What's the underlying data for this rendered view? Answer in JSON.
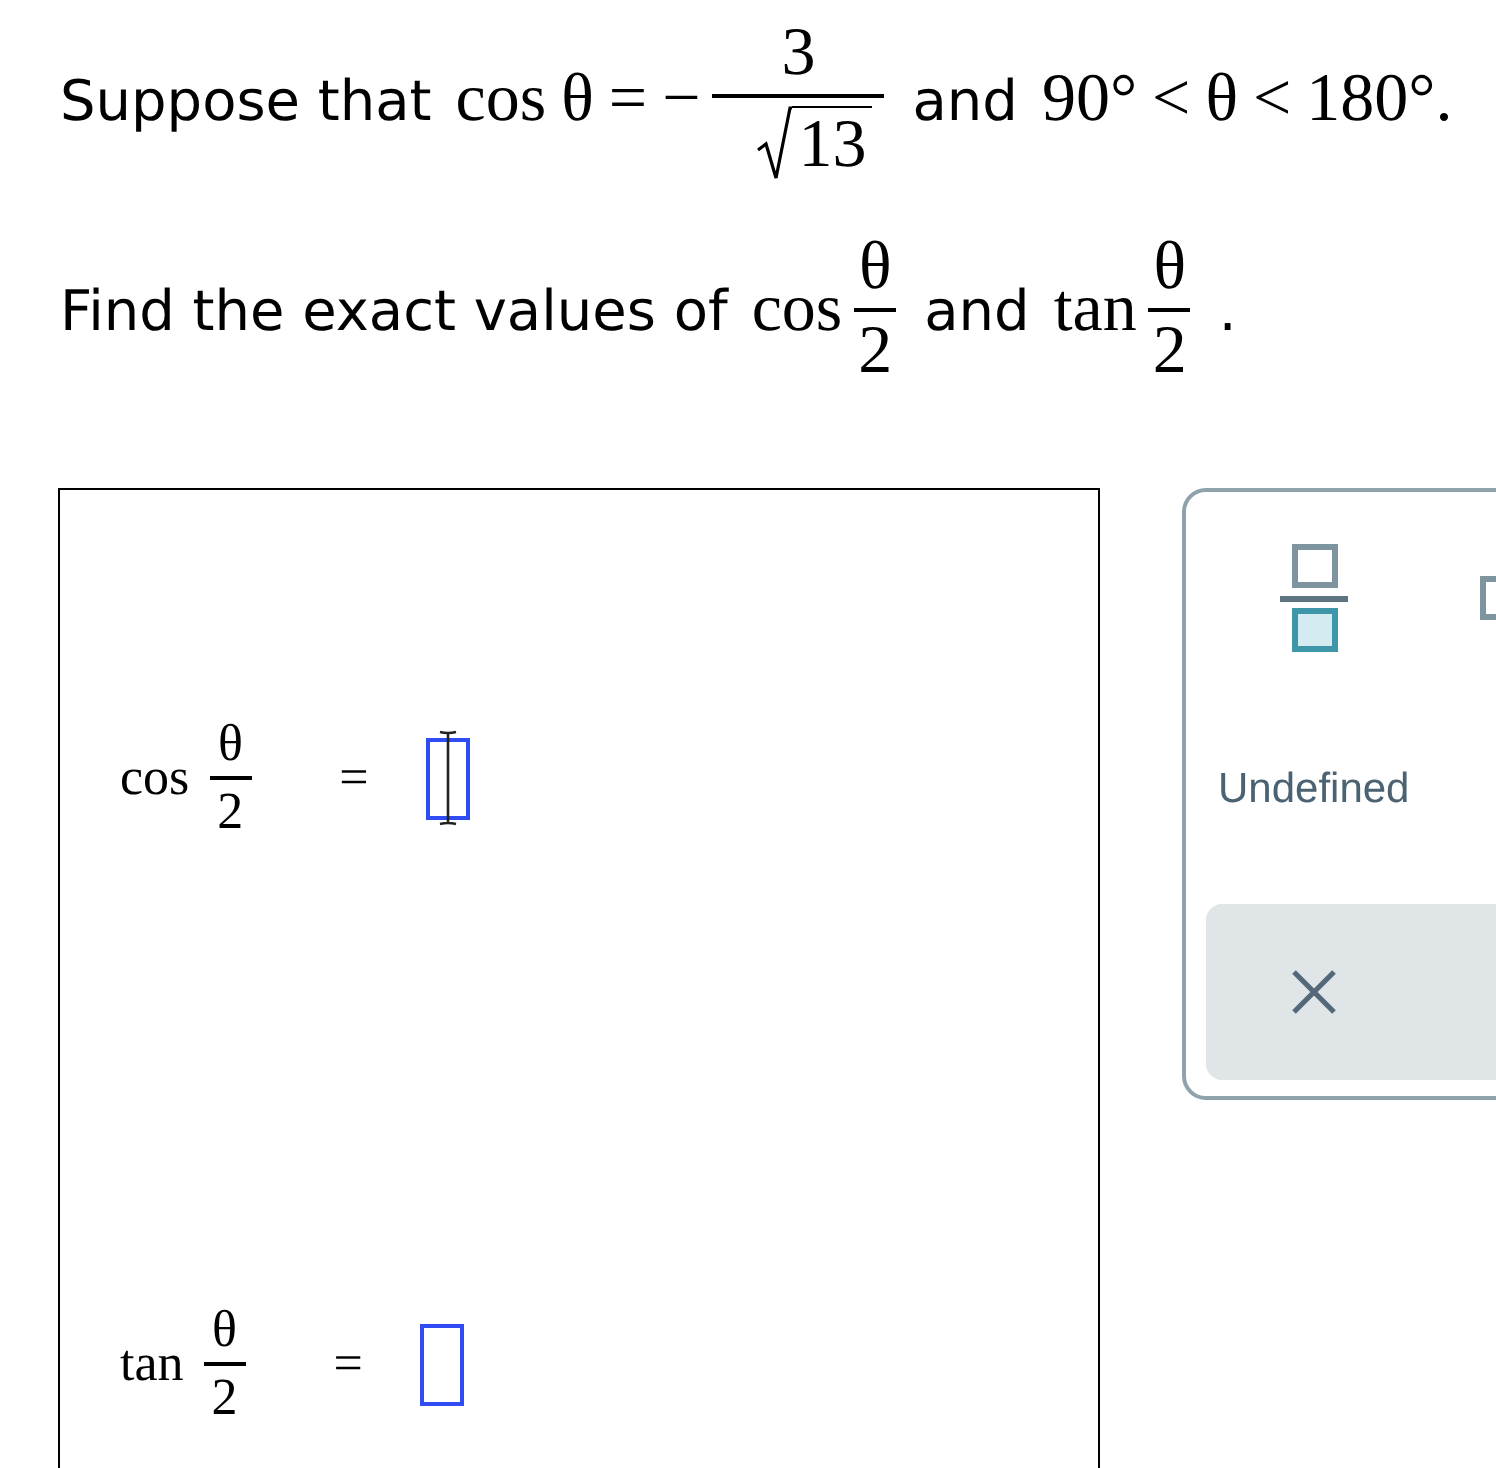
{
  "question": [
    [
      {
        "kind": "text",
        "text": "Suppose that"
      },
      {
        "kind": "math",
        "text": "cos θ = −"
      },
      {
        "kind": "fraction",
        "numerator": "3",
        "denominator": "13",
        "root": true
      },
      {
        "kind": "text",
        "text": "and"
      },
      {
        "kind": "math",
        "text": "90° < θ < 180°."
      }
    ],
    [
      {
        "kind": "text",
        "text": "Find the exact values of"
      },
      {
        "kind": "math",
        "text": "cos"
      },
      {
        "kind": "fraction",
        "numerator": "θ",
        "denominator": "2",
        "root": false
      },
      {
        "kind": "text",
        "text": "and"
      },
      {
        "kind": "math",
        "text": "tan"
      },
      {
        "kind": "fraction",
        "numerator": "θ",
        "denominator": "2",
        "root": false
      },
      {
        "kind": "text",
        "text": "."
      }
    ]
  ],
  "answers": [
    {
      "function": "cos",
      "numerator": "θ",
      "denominator": "2",
      "relation": "=",
      "focused": true
    },
    {
      "function": "tan",
      "numerator": "θ",
      "denominator": "2",
      "relation": "=",
      "focused": false
    }
  ],
  "palette": {
    "tools": [
      {
        "kind": "fraction"
      },
      {
        "kind": "box"
      }
    ],
    "undefined_button": "Undefined"
  }
}
